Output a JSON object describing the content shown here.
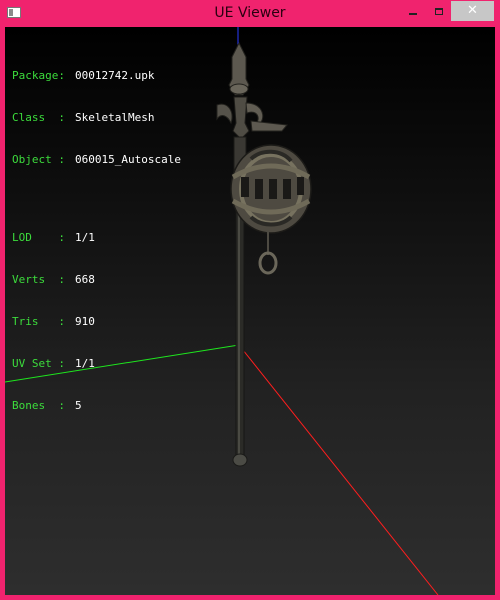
{
  "window": {
    "title": "UE Viewer",
    "close_glyph": "✕"
  },
  "info": {
    "package": {
      "key": "Package:",
      "value": "00012742.upk"
    },
    "class": {
      "key": "Class  :",
      "value": "SkeletalMesh"
    },
    "object": {
      "key": "Object :",
      "value": "060015_Autoscale"
    },
    "lod": {
      "key": "LOD    :",
      "value": "1/1"
    },
    "verts": {
      "key": "Verts  :",
      "value": "668"
    },
    "tris": {
      "key": "Tris   :",
      "value": "910"
    },
    "uvset": {
      "key": "UV Set :",
      "value": "1/1"
    },
    "bones": {
      "key": "Bones  :",
      "value": "5"
    }
  },
  "colors": {
    "title_bar": "#f0236e",
    "label_green": "#3cdc3c",
    "axis_x": "#ff1e1e",
    "axis_y": "#1ee61e",
    "axis_z": "#2a3cff"
  },
  "icons": {
    "app": "app-icon",
    "minimize": "minimize-icon",
    "maximize": "maximize-icon",
    "close": "close-icon"
  }
}
